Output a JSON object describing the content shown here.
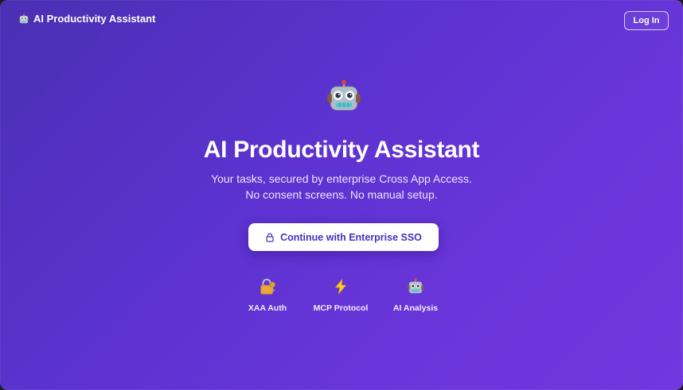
{
  "header": {
    "brand_icon": "robot-icon",
    "brand_title": "AI Productivity Assistant",
    "login_label": "Log In"
  },
  "hero": {
    "icon": "robot-icon",
    "title": "AI Productivity Assistant",
    "subtitle_line1": "Your tasks, secured by enterprise Cross App Access.",
    "subtitle_line2": "No consent screens. No manual setup."
  },
  "cta": {
    "icon": "lock-icon",
    "label": "Continue with Enterprise SSO"
  },
  "features": [
    {
      "icon": "lock-key-icon",
      "label": "XAA Auth"
    },
    {
      "icon": "lightning-icon",
      "label": "MCP Protocol"
    },
    {
      "icon": "robot-icon",
      "label": "AI Analysis"
    }
  ],
  "colors": {
    "background_start": "#4a2fb3",
    "background_end": "#7038de",
    "cta_text": "#4b2fbf",
    "cta_background": "#ffffff"
  }
}
